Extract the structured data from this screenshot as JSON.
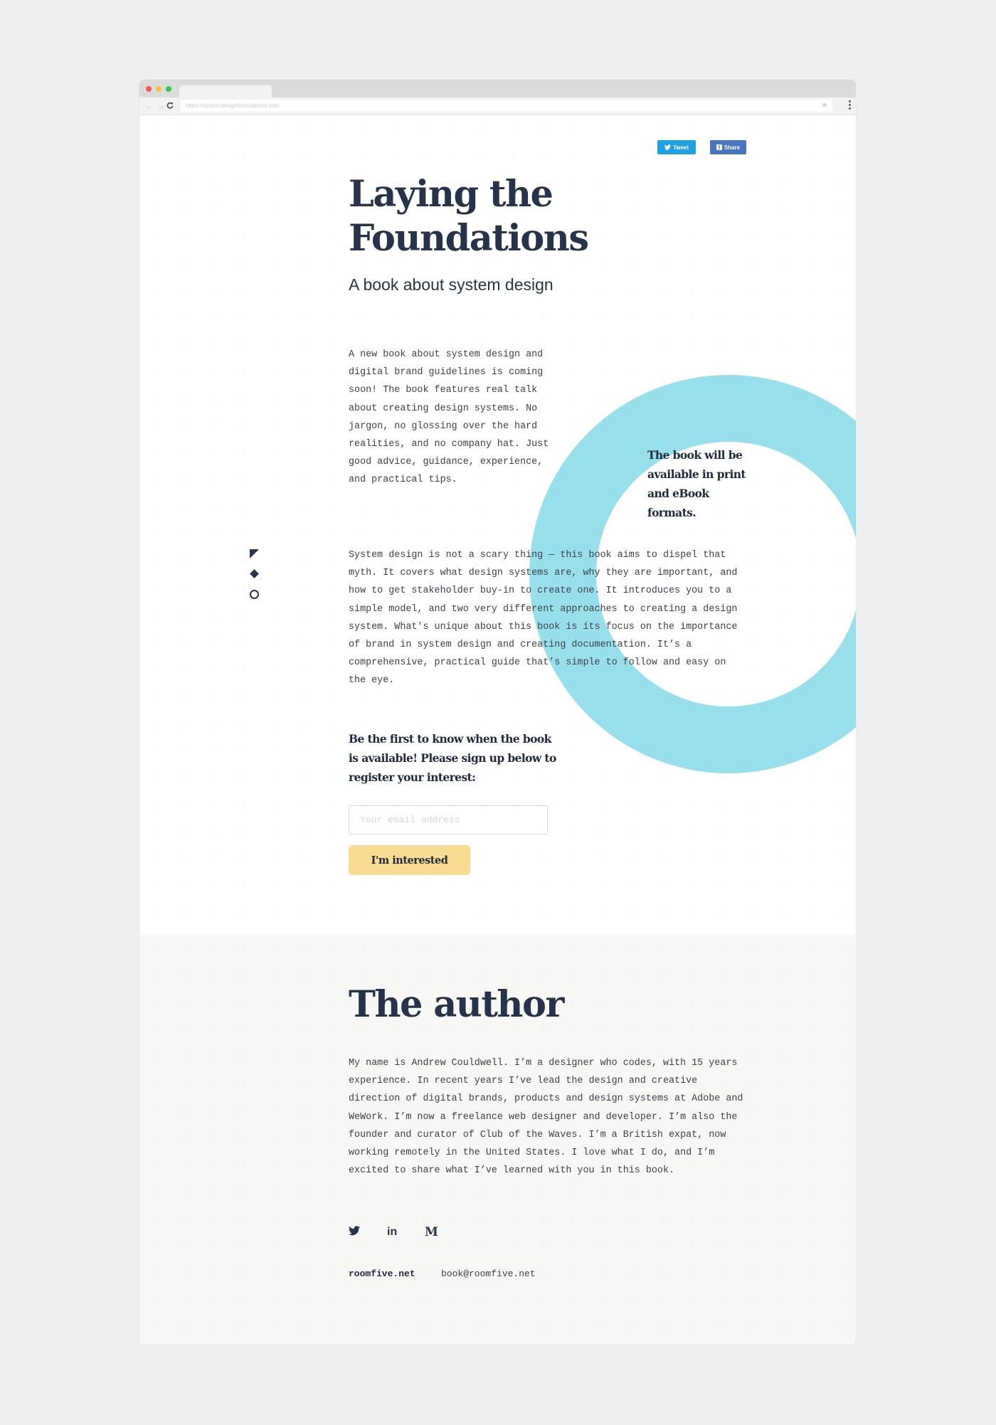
{
  "browser": {
    "url": "https://systemdesignfoundations.com",
    "back_icon": "←",
    "forward_icon": "→",
    "reload_icon": "C",
    "star_icon": "★"
  },
  "share": {
    "tweet_label": "Tweet",
    "share_label": "Share",
    "tweet_color": "#1da1e2",
    "share_color": "#4a74bd"
  },
  "hero": {
    "title_line1": "Laying the",
    "title_line2": "Foundations",
    "subtitle": "A book about system design"
  },
  "intro": {
    "paragraph": "A new book about system design and digital brand guidelines is coming soon! The book features real talk about creating design systems. No jargon, no glossing over the hard realities, and no company hat. Just good advice, guidance, experience, and practical tips.",
    "aside": "The book will be available in print and eBook formats.",
    "ring_color": "#98dfec"
  },
  "description": {
    "paragraph": "System design is not a scary thing — this book aims to dispel that myth. It covers what design systems are, why they are important, and how to get stakeholder buy-in to create one. It introduces you to a simple model, and two very different approaches to creating a design system. What's unique about this book is its focus on the importance of brand in system design and creating documentation. It’s a comprehensive, practical guide that’s simple to follow and easy on the eye."
  },
  "signup": {
    "heading": "Be the first to know when the book is available! Please sign up below to register your interest:",
    "email_value": "",
    "email_placeholder": "Your email address",
    "button_label": "I'm interested",
    "button_color": "#f8dc92"
  },
  "author": {
    "title": "The author",
    "bio": "My name is Andrew Couldwell. I’m a designer who codes, with 15 years experience. In recent years I’ve lead the design and creative direction of digital brands, products and design systems at Adobe and WeWork. I’m now a freelance web designer and developer. I’m also the founder and curator of Club of the Waves. I’m a British expat, now working remotely in the United States. I love what I do, and I’m excited to share what I’ve learned with you in this book.",
    "social": [
      {
        "name": "twitter-icon"
      },
      {
        "name": "linkedin-icon",
        "glyph": "in"
      },
      {
        "name": "medium-icon",
        "glyph": "M"
      }
    ],
    "website": "roomfive.net",
    "email": "book@roomfive.net"
  }
}
